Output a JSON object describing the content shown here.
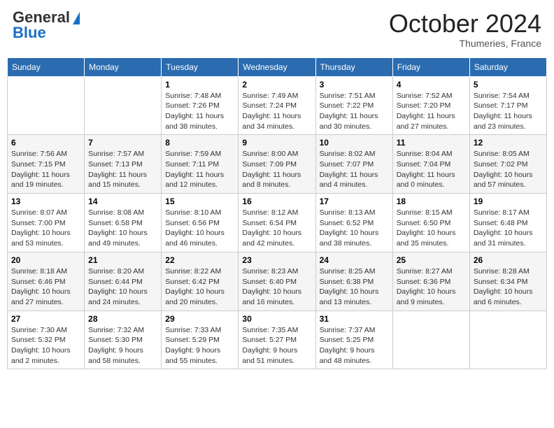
{
  "header": {
    "logo": {
      "general": "General",
      "blue": "Blue",
      "tagline": ""
    },
    "title": "October 2024",
    "location": "Thumeries, France"
  },
  "weekdays": [
    "Sunday",
    "Monday",
    "Tuesday",
    "Wednesday",
    "Thursday",
    "Friday",
    "Saturday"
  ],
  "weeks": [
    [
      {
        "day": "",
        "sunrise": "",
        "sunset": "",
        "daylight": ""
      },
      {
        "day": "",
        "sunrise": "",
        "sunset": "",
        "daylight": ""
      },
      {
        "day": "1",
        "sunrise": "Sunrise: 7:48 AM",
        "sunset": "Sunset: 7:26 PM",
        "daylight": "Daylight: 11 hours and 38 minutes."
      },
      {
        "day": "2",
        "sunrise": "Sunrise: 7:49 AM",
        "sunset": "Sunset: 7:24 PM",
        "daylight": "Daylight: 11 hours and 34 minutes."
      },
      {
        "day": "3",
        "sunrise": "Sunrise: 7:51 AM",
        "sunset": "Sunset: 7:22 PM",
        "daylight": "Daylight: 11 hours and 30 minutes."
      },
      {
        "day": "4",
        "sunrise": "Sunrise: 7:52 AM",
        "sunset": "Sunset: 7:20 PM",
        "daylight": "Daylight: 11 hours and 27 minutes."
      },
      {
        "day": "5",
        "sunrise": "Sunrise: 7:54 AM",
        "sunset": "Sunset: 7:17 PM",
        "daylight": "Daylight: 11 hours and 23 minutes."
      }
    ],
    [
      {
        "day": "6",
        "sunrise": "Sunrise: 7:56 AM",
        "sunset": "Sunset: 7:15 PM",
        "daylight": "Daylight: 11 hours and 19 minutes."
      },
      {
        "day": "7",
        "sunrise": "Sunrise: 7:57 AM",
        "sunset": "Sunset: 7:13 PM",
        "daylight": "Daylight: 11 hours and 15 minutes."
      },
      {
        "day": "8",
        "sunrise": "Sunrise: 7:59 AM",
        "sunset": "Sunset: 7:11 PM",
        "daylight": "Daylight: 11 hours and 12 minutes."
      },
      {
        "day": "9",
        "sunrise": "Sunrise: 8:00 AM",
        "sunset": "Sunset: 7:09 PM",
        "daylight": "Daylight: 11 hours and 8 minutes."
      },
      {
        "day": "10",
        "sunrise": "Sunrise: 8:02 AM",
        "sunset": "Sunset: 7:07 PM",
        "daylight": "Daylight: 11 hours and 4 minutes."
      },
      {
        "day": "11",
        "sunrise": "Sunrise: 8:04 AM",
        "sunset": "Sunset: 7:04 PM",
        "daylight": "Daylight: 11 hours and 0 minutes."
      },
      {
        "day": "12",
        "sunrise": "Sunrise: 8:05 AM",
        "sunset": "Sunset: 7:02 PM",
        "daylight": "Daylight: 10 hours and 57 minutes."
      }
    ],
    [
      {
        "day": "13",
        "sunrise": "Sunrise: 8:07 AM",
        "sunset": "Sunset: 7:00 PM",
        "daylight": "Daylight: 10 hours and 53 minutes."
      },
      {
        "day": "14",
        "sunrise": "Sunrise: 8:08 AM",
        "sunset": "Sunset: 6:58 PM",
        "daylight": "Daylight: 10 hours and 49 minutes."
      },
      {
        "day": "15",
        "sunrise": "Sunrise: 8:10 AM",
        "sunset": "Sunset: 6:56 PM",
        "daylight": "Daylight: 10 hours and 46 minutes."
      },
      {
        "day": "16",
        "sunrise": "Sunrise: 8:12 AM",
        "sunset": "Sunset: 6:54 PM",
        "daylight": "Daylight: 10 hours and 42 minutes."
      },
      {
        "day": "17",
        "sunrise": "Sunrise: 8:13 AM",
        "sunset": "Sunset: 6:52 PM",
        "daylight": "Daylight: 10 hours and 38 minutes."
      },
      {
        "day": "18",
        "sunrise": "Sunrise: 8:15 AM",
        "sunset": "Sunset: 6:50 PM",
        "daylight": "Daylight: 10 hours and 35 minutes."
      },
      {
        "day": "19",
        "sunrise": "Sunrise: 8:17 AM",
        "sunset": "Sunset: 6:48 PM",
        "daylight": "Daylight: 10 hours and 31 minutes."
      }
    ],
    [
      {
        "day": "20",
        "sunrise": "Sunrise: 8:18 AM",
        "sunset": "Sunset: 6:46 PM",
        "daylight": "Daylight: 10 hours and 27 minutes."
      },
      {
        "day": "21",
        "sunrise": "Sunrise: 8:20 AM",
        "sunset": "Sunset: 6:44 PM",
        "daylight": "Daylight: 10 hours and 24 minutes."
      },
      {
        "day": "22",
        "sunrise": "Sunrise: 8:22 AM",
        "sunset": "Sunset: 6:42 PM",
        "daylight": "Daylight: 10 hours and 20 minutes."
      },
      {
        "day": "23",
        "sunrise": "Sunrise: 8:23 AM",
        "sunset": "Sunset: 6:40 PM",
        "daylight": "Daylight: 10 hours and 16 minutes."
      },
      {
        "day": "24",
        "sunrise": "Sunrise: 8:25 AM",
        "sunset": "Sunset: 6:38 PM",
        "daylight": "Daylight: 10 hours and 13 minutes."
      },
      {
        "day": "25",
        "sunrise": "Sunrise: 8:27 AM",
        "sunset": "Sunset: 6:36 PM",
        "daylight": "Daylight: 10 hours and 9 minutes."
      },
      {
        "day": "26",
        "sunrise": "Sunrise: 8:28 AM",
        "sunset": "Sunset: 6:34 PM",
        "daylight": "Daylight: 10 hours and 6 minutes."
      }
    ],
    [
      {
        "day": "27",
        "sunrise": "Sunrise: 7:30 AM",
        "sunset": "Sunset: 5:32 PM",
        "daylight": "Daylight: 10 hours and 2 minutes."
      },
      {
        "day": "28",
        "sunrise": "Sunrise: 7:32 AM",
        "sunset": "Sunset: 5:30 PM",
        "daylight": "Daylight: 9 hours and 58 minutes."
      },
      {
        "day": "29",
        "sunrise": "Sunrise: 7:33 AM",
        "sunset": "Sunset: 5:29 PM",
        "daylight": "Daylight: 9 hours and 55 minutes."
      },
      {
        "day": "30",
        "sunrise": "Sunrise: 7:35 AM",
        "sunset": "Sunset: 5:27 PM",
        "daylight": "Daylight: 9 hours and 51 minutes."
      },
      {
        "day": "31",
        "sunrise": "Sunrise: 7:37 AM",
        "sunset": "Sunset: 5:25 PM",
        "daylight": "Daylight: 9 hours and 48 minutes."
      },
      {
        "day": "",
        "sunrise": "",
        "sunset": "",
        "daylight": ""
      },
      {
        "day": "",
        "sunrise": "",
        "sunset": "",
        "daylight": ""
      }
    ]
  ]
}
